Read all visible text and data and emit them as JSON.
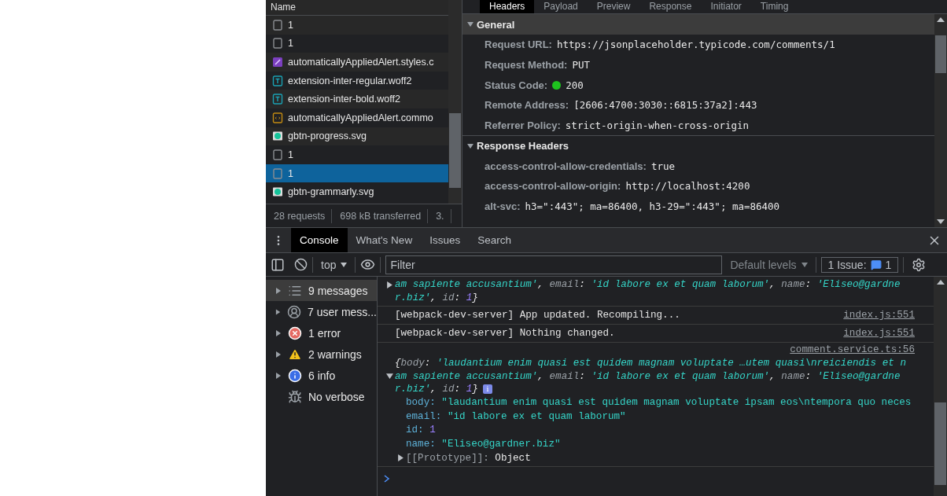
{
  "network": {
    "header": "Name",
    "requests": [
      {
        "name": "1",
        "kind": "other",
        "selected": false
      },
      {
        "name": "1",
        "kind": "other",
        "selected": false
      },
      {
        "name": "automaticallyAppliedAlert.styles.c",
        "kind": "css",
        "selected": false
      },
      {
        "name": "extension-inter-regular.woff2",
        "kind": "font",
        "selected": false
      },
      {
        "name": "extension-inter-bold.woff2",
        "kind": "font",
        "selected": false
      },
      {
        "name": "automaticallyAppliedAlert.commo",
        "kind": "script",
        "selected": false
      },
      {
        "name": "gbtn-progress.svg",
        "kind": "image",
        "selected": false
      },
      {
        "name": "1",
        "kind": "other",
        "selected": false
      },
      {
        "name": "1",
        "kind": "other",
        "selected": true
      },
      {
        "name": "gbtn-grammarly.svg",
        "kind": "image",
        "selected": false
      }
    ],
    "summary": [
      "28 requests",
      "698 kB transferred",
      "3."
    ]
  },
  "details": {
    "tabs": [
      {
        "label": "Headers",
        "selected": true
      },
      {
        "label": "Payload",
        "selected": false
      },
      {
        "label": "Preview",
        "selected": false
      },
      {
        "label": "Response",
        "selected": false
      },
      {
        "label": "Initiator",
        "selected": false
      },
      {
        "label": "Timing",
        "selected": false
      }
    ],
    "sections": [
      {
        "title": "General",
        "expanded": true,
        "rows": [
          {
            "key": "Request URL:",
            "value": "https://jsonplaceholder.typicode.com/comments/1",
            "kind": "text"
          },
          {
            "key": "Request Method:",
            "value": "PUT",
            "kind": "text"
          },
          {
            "key": "Status Code:",
            "value": "200",
            "kind": "status"
          },
          {
            "key": "Remote Address:",
            "value": "[2606:4700:3030::6815:37a2]:443",
            "kind": "text"
          },
          {
            "key": "Referrer Policy:",
            "value": "strict-origin-when-cross-origin",
            "kind": "text"
          }
        ]
      },
      {
        "title": "Response Headers",
        "expanded": true,
        "rows": [
          {
            "key": "access-control-allow-credentials:",
            "value": "true",
            "kind": "text"
          },
          {
            "key": "access-control-allow-origin:",
            "value": "http://localhost:4200",
            "kind": "text"
          },
          {
            "key": "alt-svc:",
            "value": "h3=\":443\"; ma=86400, h3-29=\":443\"; ma=86400",
            "kind": "text"
          }
        ]
      }
    ]
  },
  "drawer": {
    "tabs": [
      {
        "label": "Console",
        "selected": true
      },
      {
        "label": "What's New",
        "selected": false
      },
      {
        "label": "Issues",
        "selected": false
      },
      {
        "label": "Search",
        "selected": false
      }
    ],
    "context": "top",
    "filter_placeholder": "Filter",
    "levels": "Default levels",
    "issues_label": "1 Issue:",
    "issues_count": "1"
  },
  "sidebar": [
    {
      "label": "9 messages",
      "kind": "list",
      "selected": true
    },
    {
      "label": "7 user mess...",
      "kind": "user",
      "selected": false
    },
    {
      "label": "1 error",
      "kind": "error",
      "selected": false
    },
    {
      "label": "2 warnings",
      "kind": "warning",
      "selected": false
    },
    {
      "label": "6 info",
      "kind": "info",
      "selected": false
    },
    {
      "label": "No verbose",
      "kind": "verbose",
      "selected": false
    }
  ],
  "messages": [
    {
      "kind": "object",
      "expanded": false,
      "lines": [
        [
          {
            "kind": "string",
            "text": "am sapiente accusantium'"
          },
          {
            "kind": "plain",
            "text": ", "
          },
          {
            "kind": "key",
            "text": "email"
          },
          {
            "kind": "plain",
            "text": ": "
          },
          {
            "kind": "string",
            "text": "'id labore ex et quam laborum'"
          },
          {
            "kind": "plain",
            "text": ", "
          },
          {
            "kind": "key",
            "text": "name"
          },
          {
            "kind": "plain",
            "text": ": "
          },
          {
            "kind": "string",
            "text": "'Eliseo@gardne"
          }
        ],
        [
          {
            "kind": "string",
            "text": "r.biz'"
          },
          {
            "kind": "plain",
            "text": ", "
          },
          {
            "kind": "key",
            "text": "id"
          },
          {
            "kind": "plain",
            "text": ": "
          },
          {
            "kind": "number",
            "text": "1"
          },
          {
            "kind": "plain",
            "text": "}"
          }
        ]
      ]
    },
    {
      "kind": "log",
      "source": "index.js:551",
      "text": "[webpack-dev-server] App updated. Recompiling..."
    },
    {
      "kind": "log",
      "source": "index.js:551",
      "text": "[webpack-dev-server] Nothing changed."
    },
    {
      "kind": "object",
      "source": "comment.service.ts:56",
      "expanded": true,
      "badge": "i",
      "lines": [
        [
          {
            "kind": "plain",
            "text": "{"
          },
          {
            "kind": "key",
            "text": "body"
          },
          {
            "kind": "plain",
            "text": ": "
          },
          {
            "kind": "string",
            "text": "'laudantium enim quasi est quidem magnam voluptate …utem quasi\\nreiciendis et n"
          }
        ],
        [
          {
            "kind": "string",
            "text": "am sapiente accusantium'"
          },
          {
            "kind": "plain",
            "text": ", "
          },
          {
            "kind": "key",
            "text": "email"
          },
          {
            "kind": "plain",
            "text": ": "
          },
          {
            "kind": "string",
            "text": "'id labore ex et quam laborum'"
          },
          {
            "kind": "plain",
            "text": ", "
          },
          {
            "kind": "key",
            "text": "name"
          },
          {
            "kind": "plain",
            "text": ": "
          },
          {
            "kind": "string",
            "text": "'Eliseo@gardne"
          }
        ],
        [
          {
            "kind": "string",
            "text": "r.biz'"
          },
          {
            "kind": "plain",
            "text": ", "
          },
          {
            "kind": "key",
            "text": "id"
          },
          {
            "kind": "plain",
            "text": ": "
          },
          {
            "kind": "number",
            "text": "1"
          },
          {
            "kind": "plain",
            "text": "}"
          }
        ]
      ],
      "properties": [
        {
          "key": "body:",
          "value": "\"laudantium enim quasi est quidem magnam voluptate ipsam eos\\ntempora quo neces",
          "kind": "string"
        },
        {
          "key": "email:",
          "value": "\"id labore ex et quam laborum\"",
          "kind": "string"
        },
        {
          "key": "id:",
          "value": "1",
          "kind": "number"
        },
        {
          "key": "name:",
          "value": "\"Eliseo@gardner.biz\"",
          "kind": "string"
        }
      ],
      "prototype": {
        "key": "[[Prototype]]:",
        "value": "Object"
      }
    }
  ]
}
